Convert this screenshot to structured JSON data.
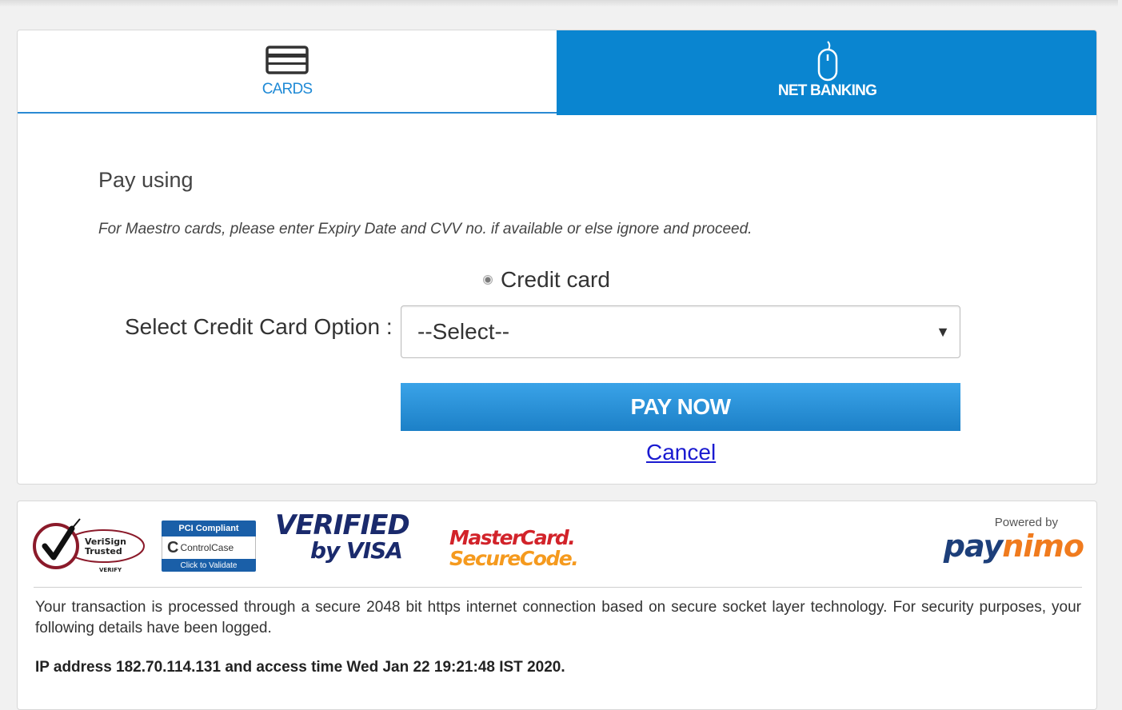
{
  "tabs": {
    "cards": {
      "label": "CARDS",
      "icon": "card-icon"
    },
    "net_banking": {
      "label": "NET BANKING",
      "icon": "mouse-icon"
    }
  },
  "payment": {
    "heading": "Pay using",
    "maestro_note": "For Maestro cards, please enter Expiry Date and CVV no. if available or else ignore and proceed.",
    "radio_label": "Credit card",
    "select_label": "Select Credit Card Option :",
    "select_value": "--Select--",
    "pay_button": "PAY NOW",
    "cancel_link": "Cancel"
  },
  "footer": {
    "logos": {
      "verisign": [
        "VeriSign",
        "Trusted",
        "VERIFY"
      ],
      "pci": {
        "top": "PCI Compliant",
        "mid_letter": "C",
        "mid_text": "ControlCase",
        "bottom": "Click to Validate"
      },
      "vbv": {
        "line1": "VERIFIED",
        "line2": "by VISA"
      },
      "mastercard": {
        "line1": "MasterCard.",
        "line2": "SecureCode."
      },
      "powered_by": "Powered by",
      "paynimo_pay": "pay",
      "paynimo_nimo": "nimo"
    },
    "secure_text": "Your transaction is processed through a secure 2048 bit https internet connection based on secure socket layer technology. For security purposes, your following details have been logged.",
    "ip_text": "IP address 182.70.114.131 and access time Wed Jan 22 19:21:48 IST 2020."
  },
  "colors": {
    "accent": "#0a85d0",
    "pay_button": "#2a92d8",
    "cancel_link": "#1a1ad0"
  }
}
